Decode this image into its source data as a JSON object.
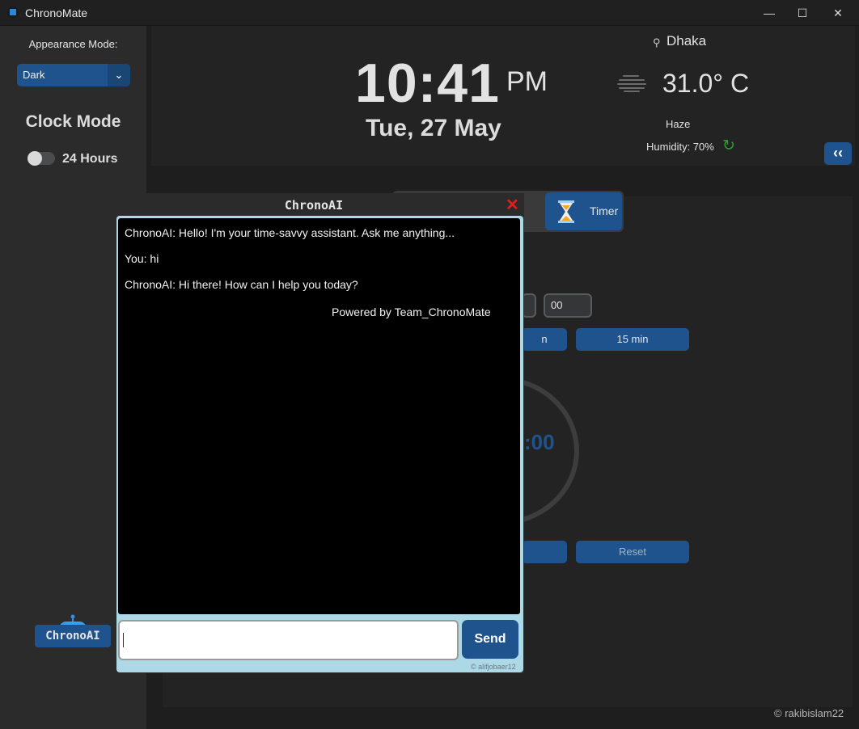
{
  "window": {
    "title": "ChronoMate"
  },
  "sidebar": {
    "appearance_label": "Appearance Mode:",
    "appearance_value": "Dark",
    "clock_mode_title": "Clock Mode",
    "hour_toggle_label": "24 Hours",
    "hour_toggle_on": false,
    "ai_button_label": "ChronoAI"
  },
  "clock": {
    "time": "10:41",
    "ampm": "PM",
    "date": "Tue, 27 May"
  },
  "weather": {
    "city": "Dhaka",
    "temperature": "31.0° C",
    "condition": "Haze",
    "humidity": "Humidity: 70%"
  },
  "tabs": {
    "timer_label": "Timer"
  },
  "timer": {
    "seconds_field": "00",
    "preset_right": "15 min",
    "preset_left_partial": "n",
    "countdown_partial": ":00",
    "reset_label": "Reset"
  },
  "chat_dialog": {
    "title": "ChronoAI",
    "messages": [
      "ChronoAI: Hello! I'm your time-savvy assistant. Ask me anything...",
      "You: hi",
      "ChronoAI: Hi there! How can I help you today?"
    ],
    "powered_by": "Powered by Team_ChronoMate",
    "input_value": "",
    "send_label": "Send",
    "credit": "© alifjobaer12"
  },
  "footer": {
    "credit": "© rakibislam22"
  },
  "colors": {
    "accent": "#1f538d",
    "background": "#1e1e1e",
    "panel": "#232323",
    "chat_frame": "#add8e6",
    "close_red": "#e02020",
    "refresh_green": "#2aa02a"
  },
  "icons": [
    "app-icon",
    "minimize-icon",
    "maximize-icon",
    "close-icon",
    "chevron-down-icon",
    "location-pin-icon",
    "haze-icon",
    "refresh-icon",
    "double-chevron-left-icon",
    "hourglass-icon",
    "robot-icon"
  ]
}
